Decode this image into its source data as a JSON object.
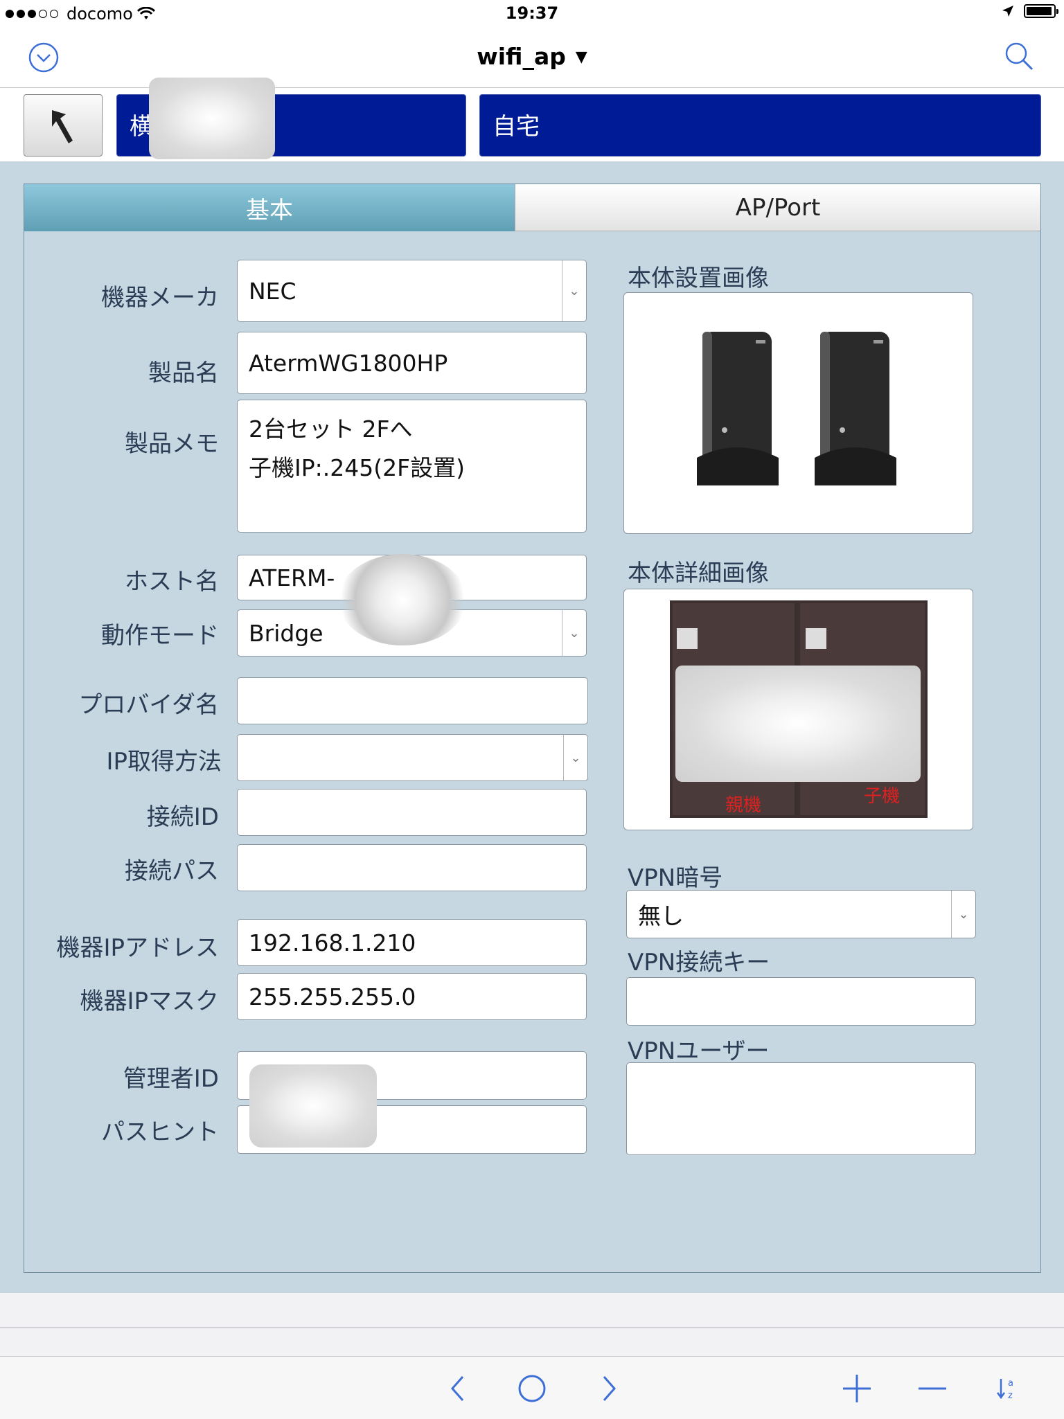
{
  "status_bar": {
    "carrier": "docomo",
    "time": "19:37"
  },
  "nav": {
    "title": "wifi_ap",
    "left_icon": "chevron-down-circle-icon",
    "right_icon": "search-icon"
  },
  "header": {
    "back_icon": "return-arrow-icon",
    "field1_text": "横",
    "field2_text": "自宅",
    "accent_color": "#001b96"
  },
  "tabs": [
    {
      "label": "基本",
      "active": true
    },
    {
      "label": "AP/Port",
      "active": false
    }
  ],
  "form": {
    "maker": {
      "label": "機器メーカ",
      "value": "NEC"
    },
    "product_name": {
      "label": "製品名",
      "value": "AtermWG1800HP"
    },
    "product_memo": {
      "label": "製品メモ",
      "line1": "2台セット 2Fへ",
      "line2": "子機IP:.245(2F設置)"
    },
    "host_name": {
      "label": "ホスト名",
      "value": "ATERM-"
    },
    "mode": {
      "label": "動作モード",
      "value": "Bridge"
    },
    "provider": {
      "label": "プロバイダ名",
      "value": ""
    },
    "ip_method": {
      "label": "IP取得方法",
      "value": ""
    },
    "conn_id": {
      "label": "接続ID",
      "value": ""
    },
    "conn_pass": {
      "label": "接続パス",
      "value": ""
    },
    "device_ip": {
      "label": "機器IPアドレス",
      "value": "192.168.1.210"
    },
    "device_mask": {
      "label": "機器IPマスク",
      "value": "255.255.255.0"
    },
    "admin_id": {
      "label": "管理者ID",
      "value": ""
    },
    "pass_hint": {
      "label": "パスヒント",
      "value": ""
    }
  },
  "right": {
    "install_image": {
      "label": "本体設置画像"
    },
    "detail_image": {
      "label": "本体詳細画像",
      "tag_parent": "親機",
      "tag_child": "子機"
    },
    "vpn_cipher": {
      "label": "VPN暗号",
      "value": "無し"
    },
    "vpn_key": {
      "label": "VPN接続キー",
      "value": ""
    },
    "vpn_user": {
      "label": "VPNユーザー",
      "value": ""
    }
  },
  "toolbar": {
    "icons": [
      "prev-icon",
      "home-circle-icon",
      "next-icon",
      "add-icon",
      "remove-icon",
      "sort-az-icon"
    ]
  }
}
